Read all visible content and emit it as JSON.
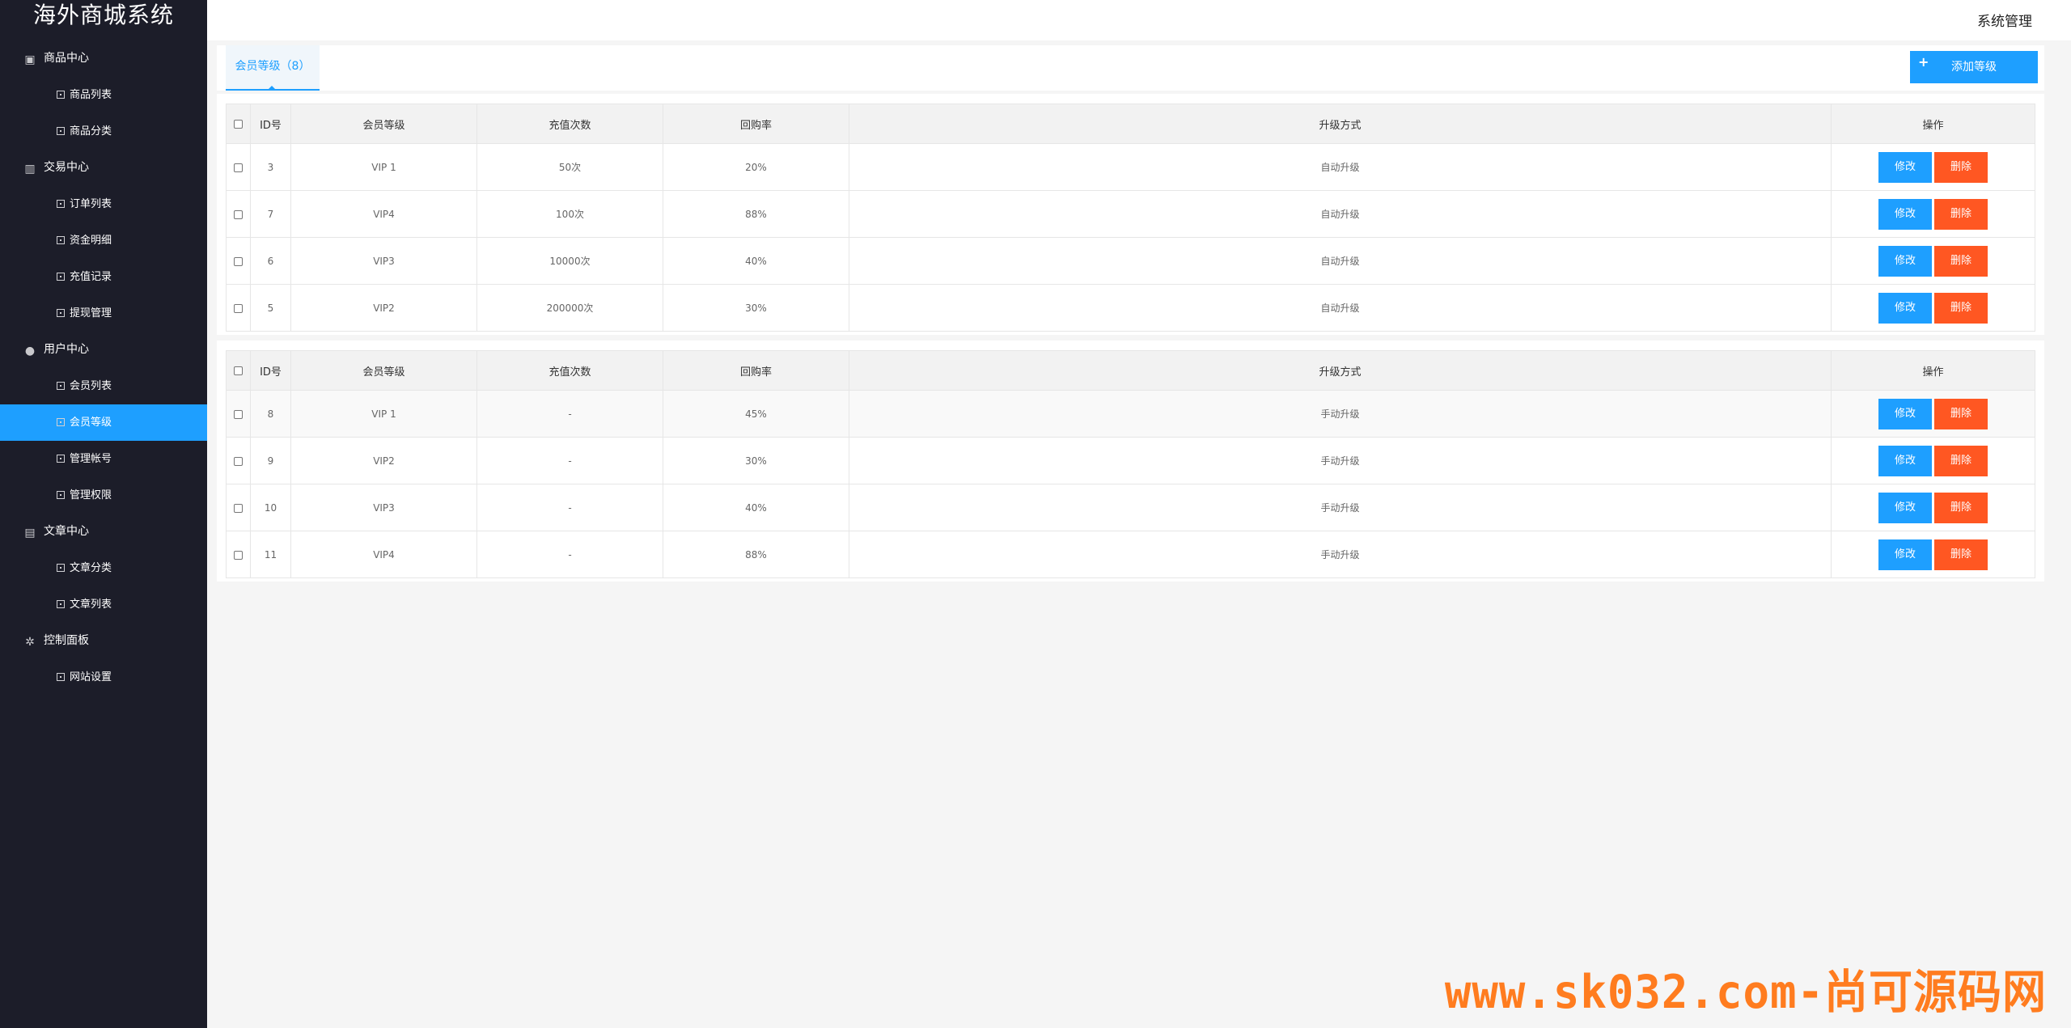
{
  "brand": "海外商城系统",
  "header": {
    "system_menu": "系统管理"
  },
  "sidebar": {
    "groups": [
      {
        "label": "商品中心",
        "icon": "box-icon",
        "items": [
          "商品列表",
          "商品分类"
        ]
      },
      {
        "label": "交易中心",
        "icon": "bar-chart-icon",
        "items": [
          "订单列表",
          "资金明细",
          "充值记录",
          "提现管理"
        ]
      },
      {
        "label": "用户中心",
        "icon": "user-icon",
        "items": [
          "会员列表",
          "会员等级",
          "管理帐号",
          "管理权限"
        ]
      },
      {
        "label": "文章中心",
        "icon": "document-icon",
        "items": [
          "文章分类",
          "文章列表"
        ]
      },
      {
        "label": "控制面板",
        "icon": "gear-icon",
        "items": [
          "网站设置"
        ]
      }
    ],
    "active_item": "会员等级"
  },
  "tabbar": {
    "tab_label": "会员等级（8）",
    "add_button": "添加等级"
  },
  "table_headers": [
    "ID号",
    "会员等级",
    "充值次数",
    "回购率",
    "升级方式",
    "操作"
  ],
  "buttons": {
    "edit": "修改",
    "delete": "删除"
  },
  "table_auto": [
    {
      "id": "3",
      "level": "VIP 1",
      "recharge": "50次",
      "rate": "20%",
      "upgrade": "自动升级"
    },
    {
      "id": "7",
      "level": "VIP4",
      "recharge": "100次",
      "rate": "88%",
      "upgrade": "自动升级"
    },
    {
      "id": "6",
      "level": "VIP3",
      "recharge": "10000次",
      "rate": "40%",
      "upgrade": "自动升级"
    },
    {
      "id": "5",
      "level": "VIP2",
      "recharge": "200000次",
      "rate": "30%",
      "upgrade": "自动升级"
    }
  ],
  "table_manual": [
    {
      "id": "8",
      "level": "VIP 1",
      "recharge": "-",
      "rate": "45%",
      "upgrade": "手动升级"
    },
    {
      "id": "9",
      "level": "VIP2",
      "recharge": "-",
      "rate": "30%",
      "upgrade": "手动升级"
    },
    {
      "id": "10",
      "level": "VIP3",
      "recharge": "-",
      "rate": "40%",
      "upgrade": "手动升级"
    },
    {
      "id": "11",
      "level": "VIP4",
      "recharge": "-",
      "rate": "88%",
      "upgrade": "手动升级"
    }
  ],
  "watermark": "www.sk032.com-尚可源码网"
}
